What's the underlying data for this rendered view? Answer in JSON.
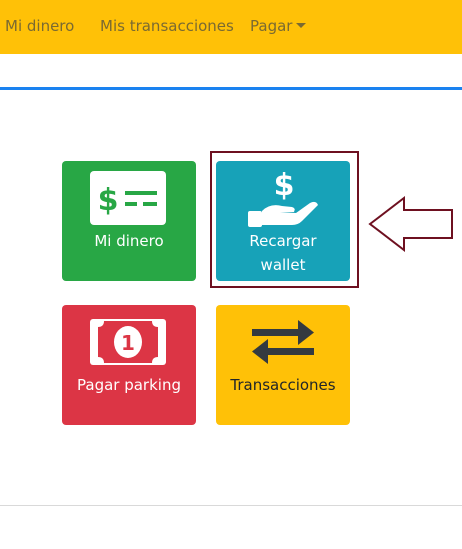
{
  "nav": {
    "items": [
      {
        "label": "Mi dinero"
      },
      {
        "label": "Mis transacciones"
      },
      {
        "label": "Pagar",
        "dropdown": true
      }
    ]
  },
  "tiles": {
    "mi_dinero": {
      "label": "Mi dinero",
      "color": "#28a745",
      "icon": "money-card-icon"
    },
    "recargar": {
      "label_line1": "Recargar",
      "label_line2": "wallet",
      "color": "#17a2b8",
      "icon": "hand-dollar-icon"
    },
    "pagar_parking": {
      "label": "Pagar parking",
      "color": "#dc3545",
      "icon": "banknote-icon"
    },
    "transacciones": {
      "label": "Transacciones",
      "color": "#ffc107",
      "icon": "exchange-arrows-icon"
    }
  },
  "annotation": {
    "highlight_color": "#6e1020",
    "pointer": "left-arrow-outline"
  }
}
